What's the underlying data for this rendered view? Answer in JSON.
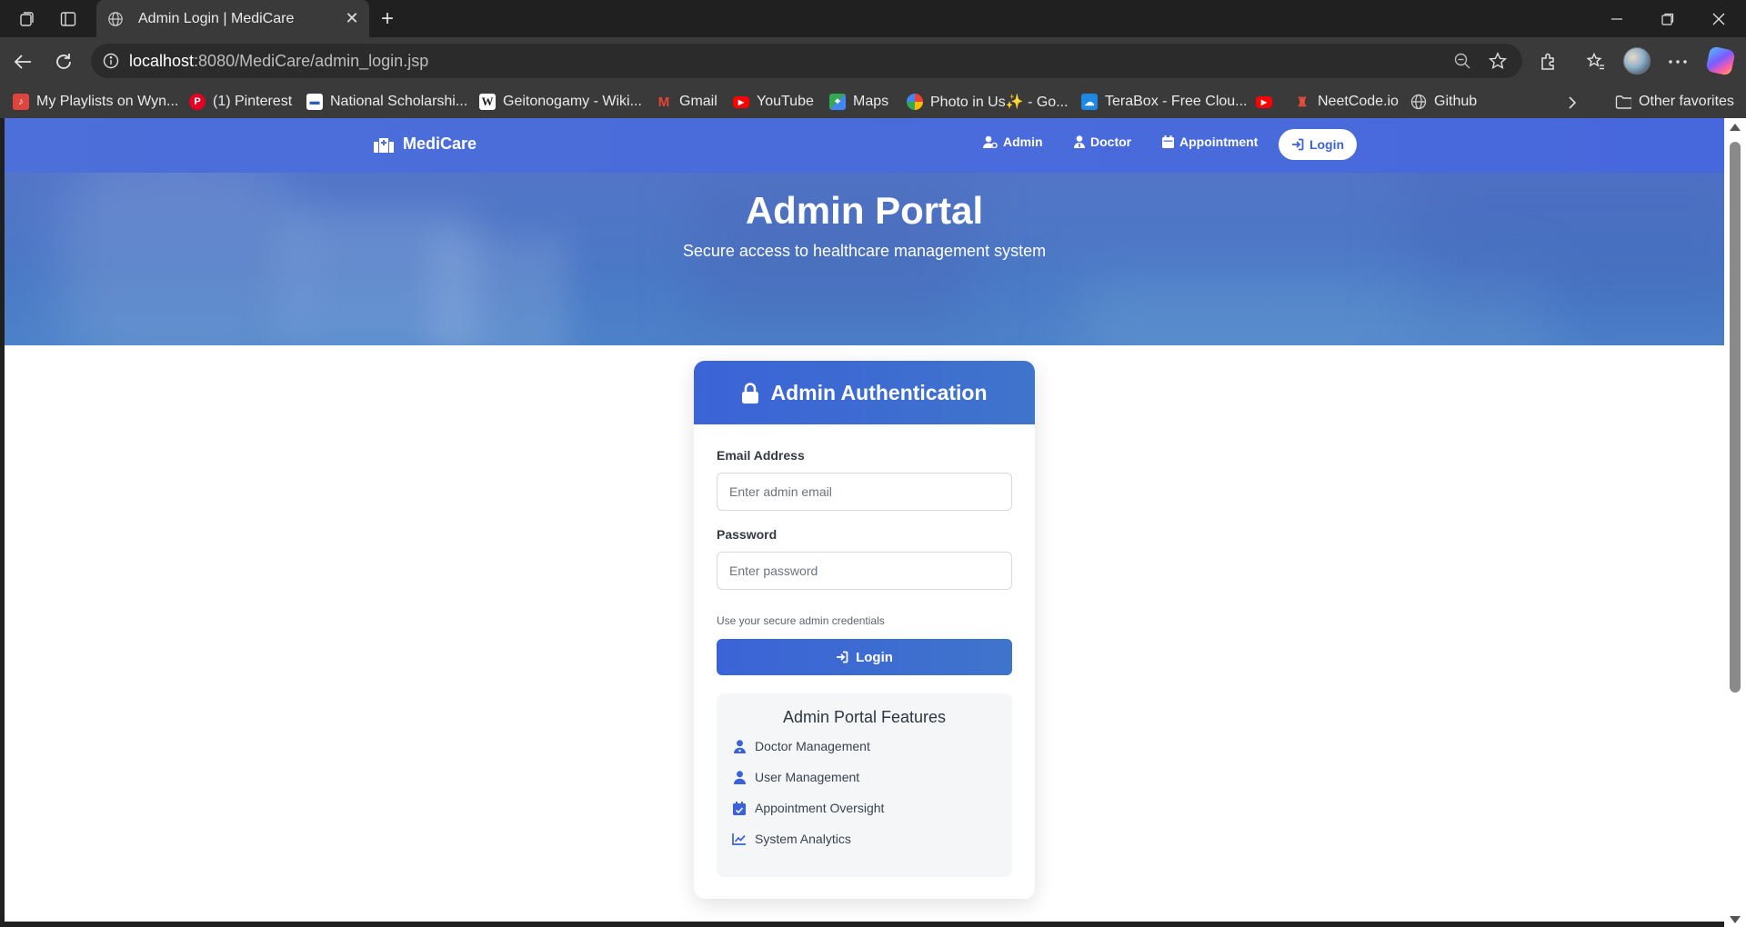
{
  "browser": {
    "tab_title": "Admin Login | MediCare",
    "url_host": "localhost",
    "url_rest": ":8080/MediCare/admin_login.jsp",
    "bookmarks": [
      {
        "label": "My Playlists on Wyn...",
        "icon": "playlist-icon",
        "color": "#e0443e"
      },
      {
        "label": "(1) Pinterest",
        "icon": "pinterest-icon",
        "color": "#e60023"
      },
      {
        "label": "National Scholarshi...",
        "icon": "scholarship-icon",
        "color": "#2b5cb8"
      },
      {
        "label": "Geitonogamy - Wiki...",
        "icon": "wikipedia-icon",
        "color": "#ffffff"
      },
      {
        "label": "Gmail",
        "icon": "gmail-icon",
        "color": "#ea4335"
      },
      {
        "label": "YouTube",
        "icon": "youtube-icon",
        "color": "#ff0000"
      },
      {
        "label": "Maps",
        "icon": "maps-icon",
        "color": "#34a853"
      },
      {
        "label": "Photo in Us✨ - Go...",
        "icon": "photos-icon",
        "color": "#fbbc05"
      },
      {
        "label": "TeraBox - Free Clou...",
        "icon": "terabox-icon",
        "color": "#1e88e5"
      },
      {
        "label": "",
        "icon": "youtube-icon",
        "color": "#ff0000"
      },
      {
        "label": "NeetCode.io",
        "icon": "neetcode-icon",
        "color": "#c0392b"
      },
      {
        "label": "Github",
        "icon": "globe-icon",
        "color": "#cccccc"
      }
    ],
    "other_favorites": "Other favorites"
  },
  "site": {
    "brand": "MediCare",
    "nav": {
      "admin": "Admin",
      "doctor": "Doctor",
      "appointment": "Appointment",
      "login": "Login"
    },
    "hero": {
      "title": "Admin Portal",
      "subtitle": "Secure access to healthcare management system"
    },
    "card": {
      "title": "Admin Authentication",
      "email_label": "Email Address",
      "email_placeholder": "Enter admin email",
      "password_label": "Password",
      "password_placeholder": "Enter password",
      "hint": "Use your secure admin credentials",
      "login_button": "Login",
      "features_title": "Admin Portal Features",
      "features": [
        {
          "label": "Doctor Management",
          "icon": "doctor-icon"
        },
        {
          "label": "User Management",
          "icon": "user-icon"
        },
        {
          "label": "Appointment Oversight",
          "icon": "calendar-check-icon"
        },
        {
          "label": "System Analytics",
          "icon": "chart-line-icon"
        }
      ]
    }
  },
  "colors": {
    "primary": "#3b63d7",
    "nav_bg": "#4c6fd9",
    "chrome_dark": "#202020",
    "chrome_mid": "#3a3a3a"
  }
}
